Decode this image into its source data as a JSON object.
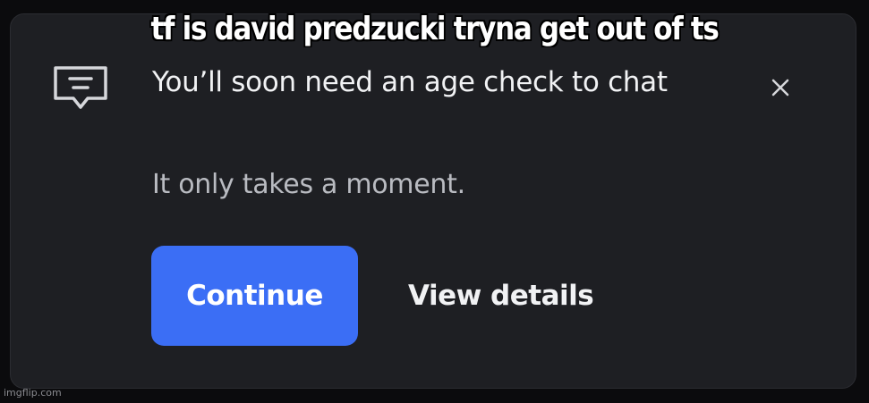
{
  "meme": {
    "caption": "tf is david predzucki tryna get out of ts",
    "watermark": "imgflip.com"
  },
  "dialog": {
    "icon": "chat-message-icon",
    "title": "You’ll soon need an age check to chat",
    "subtitle": "It only takes a moment.",
    "close_icon": "close-icon",
    "continue_label": "Continue",
    "details_label": "View details"
  },
  "colors": {
    "page_background": "#0b0b0d",
    "card_background": "#1e1f23",
    "accent": "#3b6ef5",
    "primary_text": "#f1f2f4",
    "secondary_text": "#b9bbc1"
  }
}
